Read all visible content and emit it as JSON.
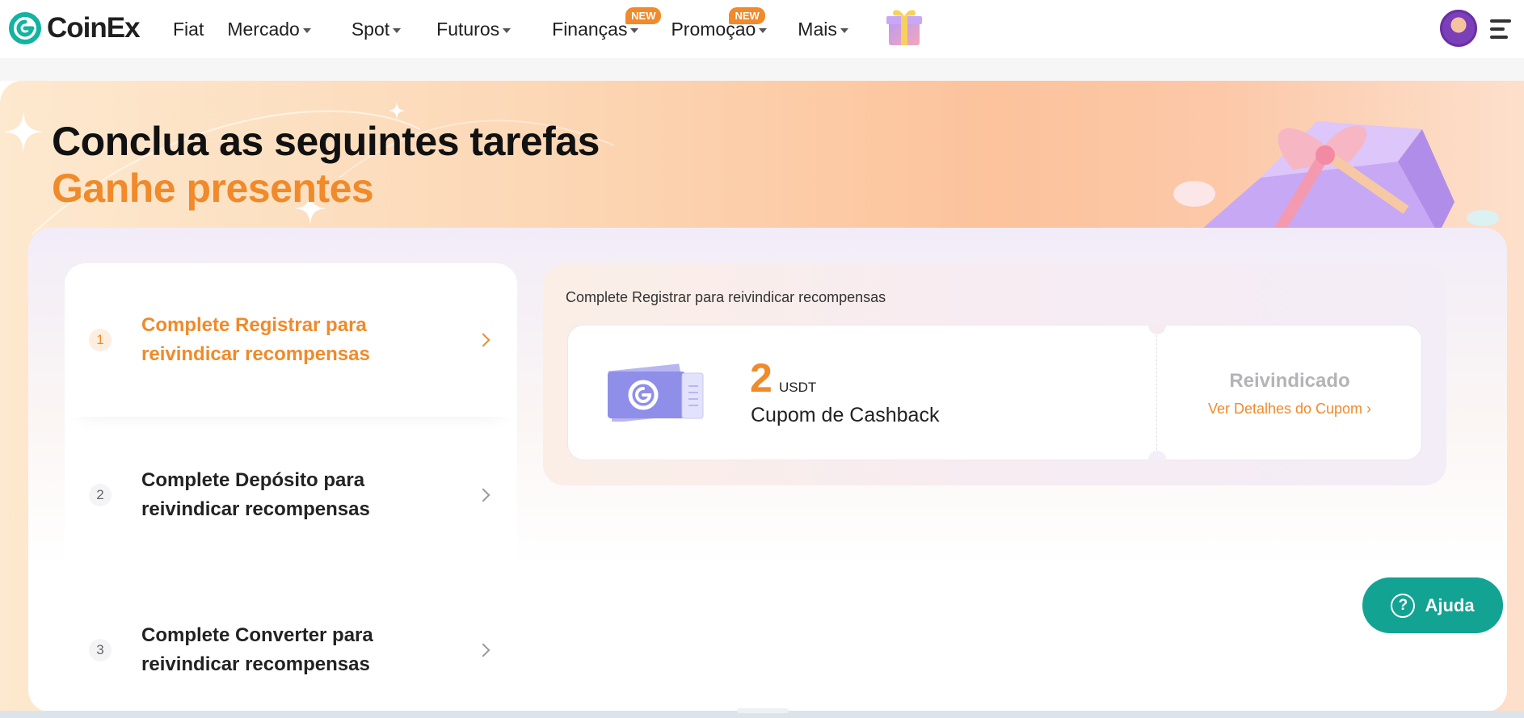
{
  "header": {
    "brand": "CoinEx",
    "nav": [
      {
        "label": "Fiat",
        "caret": false,
        "badge": ""
      },
      {
        "label": "Mercado",
        "caret": true,
        "badge": ""
      },
      {
        "label": "Spot",
        "caret": true,
        "badge": ""
      },
      {
        "label": "Futuros",
        "caret": true,
        "badge": ""
      },
      {
        "label": "Finanças",
        "caret": true,
        "badge": "NEW"
      },
      {
        "label": "Promoção",
        "caret": true,
        "badge": "NEW"
      },
      {
        "label": "Mais",
        "caret": true,
        "badge": ""
      }
    ]
  },
  "hero": {
    "title": "Conclua as seguintes tarefas",
    "subtitle": "Ganhe presentes"
  },
  "tasks": [
    {
      "num": "1",
      "label": "Complete Registrar para reivindicar recompensas",
      "active": true
    },
    {
      "num": "2",
      "label": "Complete Depósito para reivindicar recompensas",
      "active": false
    },
    {
      "num": "3",
      "label": "Complete Converter para reivindicar recompensas",
      "active": false
    }
  ],
  "detail": {
    "heading": "Complete Registrar para reivindicar recompensas",
    "coupon": {
      "amount": "2",
      "unit": "USDT",
      "name": "Cupom de Cashback",
      "status": "Reivindicado",
      "link": "Ver Detalhes do Cupom ›"
    }
  },
  "help": {
    "label": "Ajuda",
    "icon": "?"
  },
  "colors": {
    "accent": "#f08a2a",
    "help": "#13a392",
    "coupon": "#8f8ee8"
  }
}
